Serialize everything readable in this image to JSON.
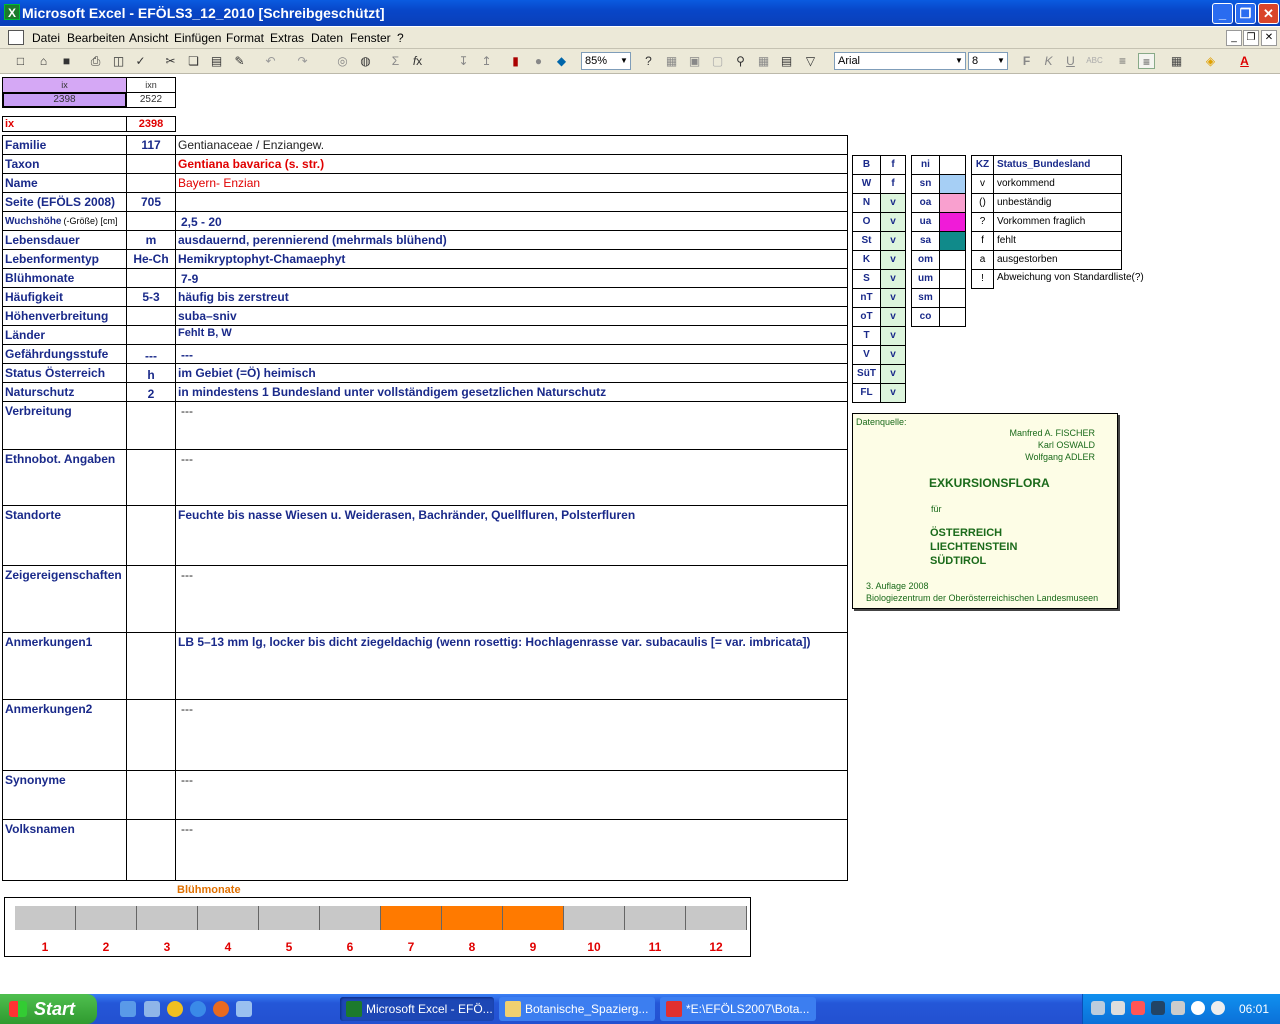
{
  "window": {
    "title": "Microsoft Excel - EFÖLS3_12_2010  [Schreibgeschützt]",
    "minimize": "_",
    "restore": "❐",
    "close": "✕"
  },
  "menu": [
    "Datei",
    "Bearbeiten",
    "Ansicht",
    "Einfügen",
    "Format",
    "Extras",
    "Daten",
    "Fenster",
    "?"
  ],
  "toolbar": {
    "zoom": "85%",
    "font": "Arial",
    "size": "8"
  },
  "top": {
    "ix_header": "ix",
    "ixn_header": "ixn",
    "ix_value": "2398",
    "ixn_value": "2522",
    "ix_label": "ix",
    "ix_red": "2398"
  },
  "rows": [
    {
      "label": "Familie",
      "code": "117",
      "value": "Gentianaceae / Enziangew."
    },
    {
      "label": "Taxon",
      "code": "",
      "value": "Gentiana bavarica (s. str.)"
    },
    {
      "label": "Name",
      "code": "",
      "value": "Bayern- Enzian"
    },
    {
      "label": "Seite (EFÖLS 2008)",
      "code": "705",
      "value": ""
    },
    {
      "label": "Wuchshöhe",
      "label_small": "(-Größe) [cm]",
      "code": "",
      "value": "2,5 - 20"
    },
    {
      "label": "Lebensdauer",
      "code": "m",
      "value": "ausdauernd, perennierend (mehrmals blühend)"
    },
    {
      "label": "Lebenformentyp",
      "code": "He-Ch",
      "value": "Hemikryptophyt-Chamaephyt"
    },
    {
      "label": "Blühmonate",
      "code": "",
      "value": "7-9"
    },
    {
      "label": "Häufigkeit",
      "code": "5-3",
      "value": "häufig bis zerstreut"
    },
    {
      "label": "Höhenverbreitung",
      "code": "",
      "value": "suba–sniv"
    },
    {
      "label": "Länder",
      "code": "",
      "value": "Fehlt B, W"
    },
    {
      "label": "Gefährdungsstufe",
      "code": "---",
      "value": "---"
    },
    {
      "label": "Status Österreich",
      "code": "h",
      "value": "im Gebiet (=Ö) heimisch"
    },
    {
      "label": "Naturschutz",
      "code": "2",
      "value": "in mindestens 1 Bundesland unter vollständigem gesetzlichen Naturschutz"
    }
  ],
  "big_rows": [
    {
      "label": "Verbreitung",
      "value": "---"
    },
    {
      "label": "Ethnobot. Angaben",
      "value": "---"
    },
    {
      "label": "Standorte",
      "value": "Feuchte bis nasse Wiesen u. Weiderasen, Bachränder, Quellfluren, Polsterfluren"
    },
    {
      "label": "Zeigereigenschaften",
      "value": "---"
    },
    {
      "label": "Anmerkungen1",
      "value": "LB 5–13 mm lg, locker bis dicht ziegeldachig (wenn rosettig: Hochlagenrasse var. subacaulis [= var. imbricata])"
    },
    {
      "label": "Anmerkungen2",
      "value": "---"
    },
    {
      "label": "Synonyme",
      "value": "---"
    },
    {
      "label": "Volksnamen",
      "value": "---"
    }
  ],
  "states": [
    {
      "k": "B",
      "v": "f"
    },
    {
      "k": "W",
      "v": "f"
    },
    {
      "k": "N",
      "v": "v"
    },
    {
      "k": "O",
      "v": "v"
    },
    {
      "k": "St",
      "v": "v"
    },
    {
      "k": "K",
      "v": "v"
    },
    {
      "k": "S",
      "v": "v"
    },
    {
      "k": "nT",
      "v": "v"
    },
    {
      "k": "oT",
      "v": "v"
    },
    {
      "k": "T",
      "v": "v"
    },
    {
      "k": "V",
      "v": "v"
    },
    {
      "k": "SüT",
      "v": "v"
    },
    {
      "k": "FL",
      "v": "v"
    }
  ],
  "zones": [
    {
      "k": "ni",
      "color": ""
    },
    {
      "k": "sn",
      "color": "#a6cff5"
    },
    {
      "k": "oa",
      "color": "#f9a0cf"
    },
    {
      "k": "ua",
      "color": "#f01bd8"
    },
    {
      "k": "sa",
      "color": "#108a8a"
    },
    {
      "k": "om",
      "color": ""
    },
    {
      "k": "um",
      "color": ""
    },
    {
      "k": "sm",
      "color": ""
    },
    {
      "k": "co",
      "color": ""
    }
  ],
  "kz": {
    "header_k": "KZ",
    "header_v": "Status_Bundesland",
    "items": [
      {
        "k": "v",
        "v": "vorkommend"
      },
      {
        "k": "()",
        "v": "unbeständig"
      },
      {
        "k": "?",
        "v": "Vorkommen fraglich"
      },
      {
        "k": "f",
        "v": "fehlt"
      },
      {
        "k": "a",
        "v": "ausgestorben"
      },
      {
        "k": "!",
        "v": "Abweichung von Standardliste(?)"
      }
    ]
  },
  "datasource": {
    "label": "Datenquelle:",
    "a1": "Manfred A. FISCHER",
    "a2": "Karl OSWALD",
    "a3": "Wolfgang ADLER",
    "title": "EXKURSIONSFLORA",
    "fuer": "für",
    "c1": "ÖSTERREICH",
    "c2": "LIECHTENSTEIN",
    "c3": "SÜDTIROL",
    "edition": "3. Auflage 2008",
    "publisher": "Biologiezentrum der Oberösterreichischen Landesmuseen"
  },
  "bloom": {
    "title": "Blühmonate",
    "months": [
      "1",
      "2",
      "3",
      "4",
      "5",
      "6",
      "7",
      "8",
      "9",
      "10",
      "11",
      "12"
    ],
    "active": [
      7,
      8,
      9
    ],
    "active_color": "#ff7a00"
  },
  "taskbar": {
    "start": "Start",
    "items": [
      "Microsoft Excel - EFÖ...",
      "Botanische_Spazierg...",
      "*E:\\EFÖLS2007\\Bota..."
    ],
    "clock": "06:01"
  }
}
